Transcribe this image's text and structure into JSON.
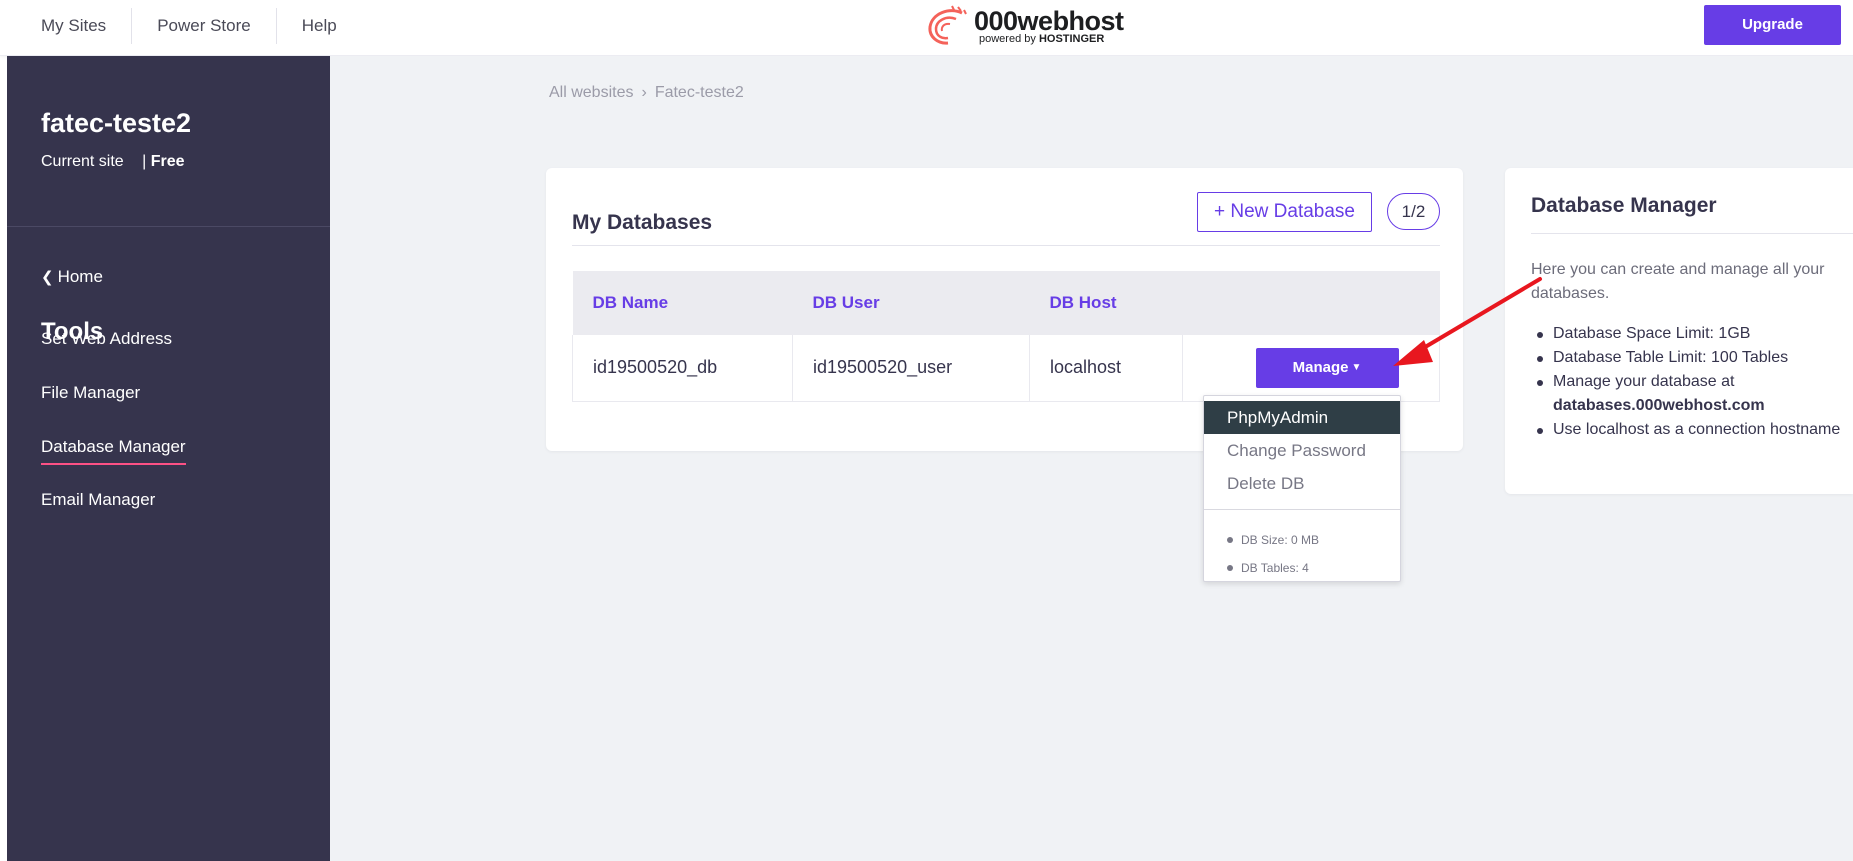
{
  "topnav": {
    "items": [
      "My Sites",
      "Power Store",
      "Help"
    ],
    "logo_text": "000webhost",
    "logo_sub_prefix": "powered by",
    "logo_sub_brand": "HOSTINGER",
    "upgrade_label": "Upgrade"
  },
  "sidebar": {
    "site_name": "fatec-teste2",
    "site_label": "Current site",
    "site_separator": "|",
    "site_plan": "Free",
    "home_label": "Home",
    "tools_title": "Tools",
    "items": [
      {
        "label": "Set Web Address"
      },
      {
        "label": "File Manager"
      },
      {
        "label": "Database Manager"
      },
      {
        "label": "Email Manager"
      }
    ]
  },
  "breadcrumb": {
    "root": "All websites",
    "separator": "›",
    "current": "Fatec-teste2"
  },
  "databases": {
    "title": "My Databases",
    "new_button": "+ New Database",
    "count": "1/2",
    "columns": [
      "DB Name",
      "DB User",
      "DB Host"
    ],
    "rows": [
      {
        "name": "id19500520_db",
        "user": "id19500520_user",
        "host": "localhost"
      }
    ],
    "manage_label": "Manage"
  },
  "dropdown": {
    "items": [
      "PhpMyAdmin",
      "Change Password",
      "Delete DB"
    ],
    "stats": [
      "DB Size: 0 MB",
      "DB Tables: 4"
    ]
  },
  "info": {
    "title": "Database Manager",
    "description": "Here you can create and manage all your databases.",
    "bullets": [
      "Database Space Limit: 1GB",
      "Database Table Limit: 100 Tables",
      "Manage your database at",
      "databases.000webhost.com",
      "Use localhost as a connection hostname"
    ]
  },
  "colors": {
    "accent": "#673de6",
    "sidebar_bg": "#36344d",
    "active_underline": "#fc5185",
    "annotation_arrow": "#e8171f"
  }
}
